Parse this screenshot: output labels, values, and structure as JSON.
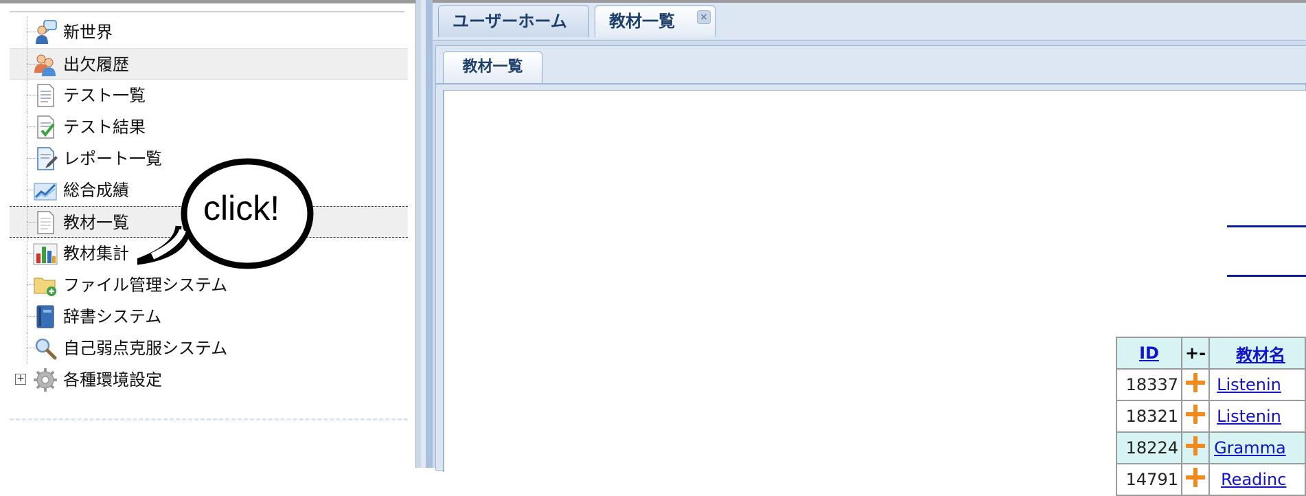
{
  "tree": {
    "items": [
      {
        "label": "新世界",
        "icon": "user-chat-icon"
      },
      {
        "label": "出欠履歴",
        "icon": "users-icon"
      },
      {
        "label": "テスト一覧",
        "icon": "document-list-icon"
      },
      {
        "label": "テスト結果",
        "icon": "document-check-icon"
      },
      {
        "label": "レポート一覧",
        "icon": "document-edit-icon"
      },
      {
        "label": "総合成績",
        "icon": "line-chart-icon"
      },
      {
        "label": "教材一覧",
        "icon": "document-icon"
      },
      {
        "label": "教材集計",
        "icon": "bar-chart-icon"
      },
      {
        "label": "ファイル管理システム",
        "icon": "folder-add-icon"
      },
      {
        "label": "辞書システム",
        "icon": "book-icon"
      },
      {
        "label": "自己弱点克服システム",
        "icon": "magnifier-icon"
      },
      {
        "label": "各種環境設定",
        "icon": "gear-icon"
      }
    ]
  },
  "callout": {
    "text": "click!"
  },
  "tabs": {
    "outer": [
      {
        "label": "ユーザーホーム"
      },
      {
        "label": "教材一覧",
        "close": "×"
      }
    ],
    "inner": [
      {
        "label": "教材一覧"
      }
    ]
  },
  "table": {
    "headers": [
      "ID",
      "+-",
      "教材名"
    ],
    "rows": [
      {
        "id": "18337",
        "name": "Listenin"
      },
      {
        "id": "18321",
        "name": "Listenin"
      },
      {
        "id": "18224",
        "name": "Gramma"
      },
      {
        "id": "14791",
        "name": "Readinc"
      }
    ]
  },
  "colors": {
    "tab_text": "#1d3f6b",
    "link": "#1313c9",
    "plus": "#f08a1c",
    "table_header_bg": "#d8f3f3"
  }
}
